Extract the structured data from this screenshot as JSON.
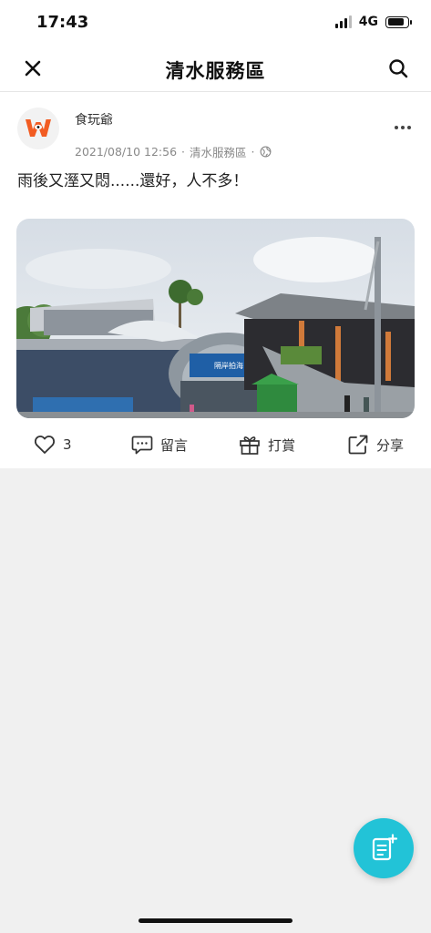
{
  "status_bar": {
    "time": "17:43",
    "network": "4G",
    "battery_level": 0.85
  },
  "nav": {
    "title": "清水服務區",
    "close_icon": "close-icon",
    "search_icon": "search-icon"
  },
  "post": {
    "author": "食玩爺",
    "date": "2021/08/10 12:56",
    "location": "清水服務區",
    "visibility_icon": "globe-icon",
    "text": "雨後又溼又悶......還好，人不多！",
    "sign_text": "隔岸拍海",
    "likes": "3",
    "comment_label": "留言",
    "gift_label": "打賞",
    "share_label": "分享"
  },
  "fab": {
    "icon": "new-post-icon"
  },
  "colors": {
    "accent": "#22c3d7",
    "avatar_logo": "#f25c22"
  }
}
